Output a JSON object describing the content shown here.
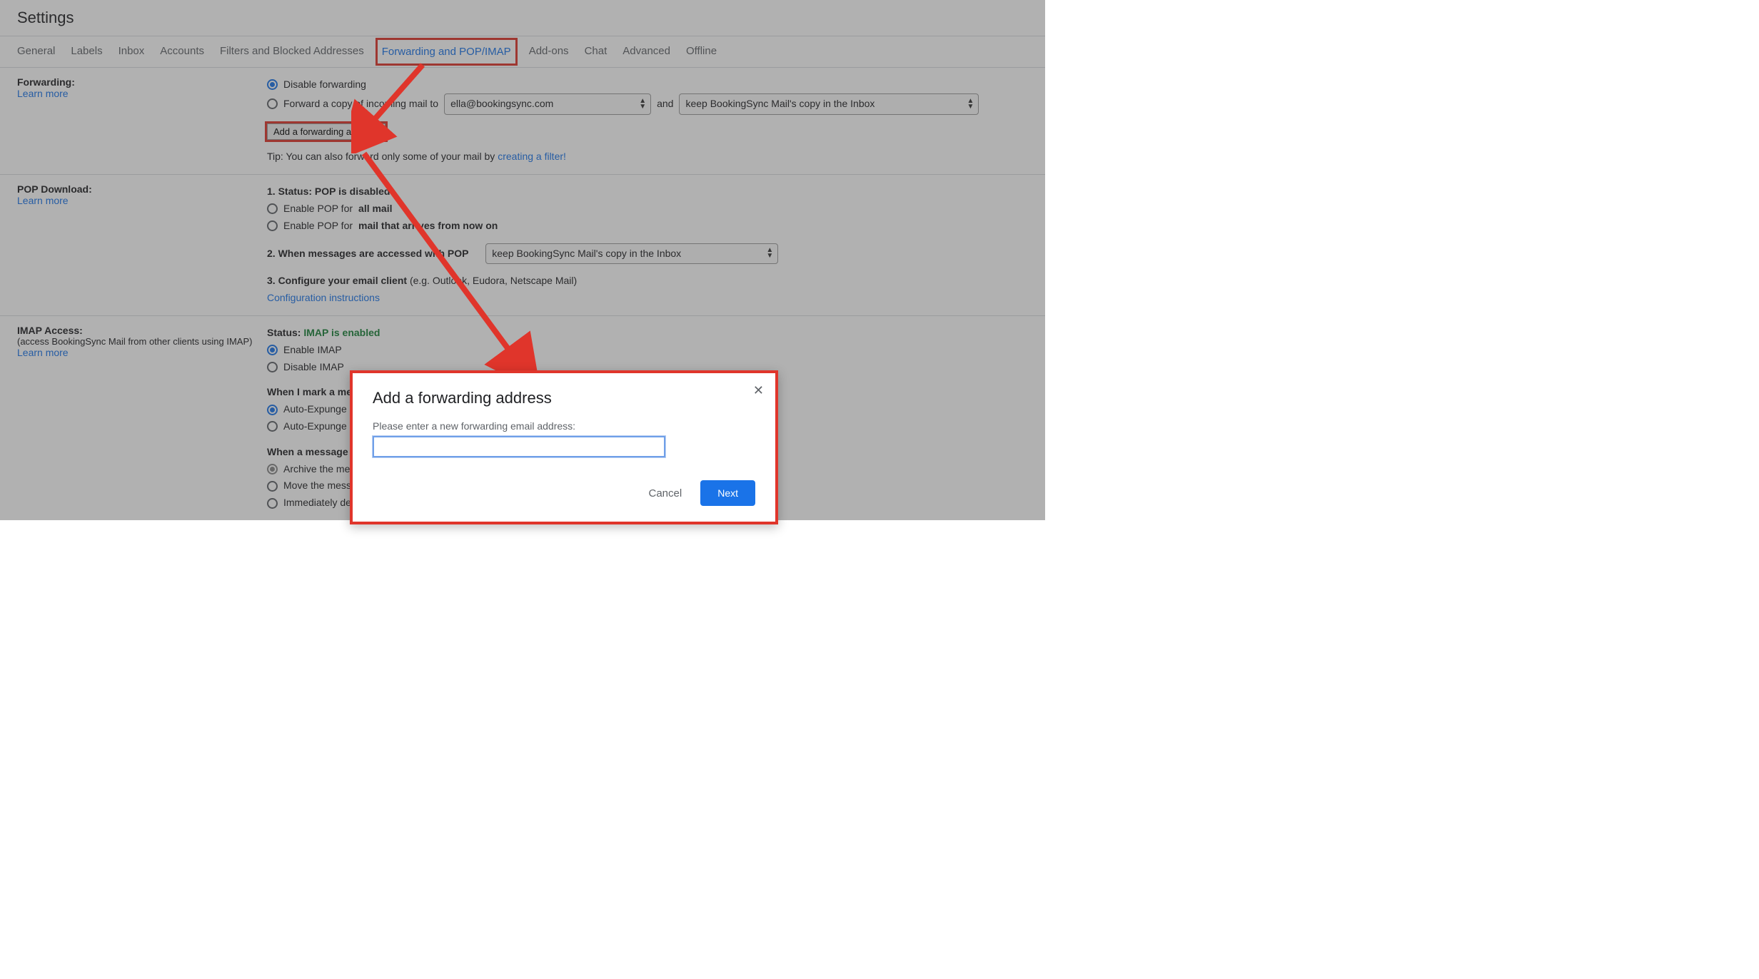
{
  "header": {
    "title": "Settings"
  },
  "tabs": [
    "General",
    "Labels",
    "Inbox",
    "Accounts",
    "Filters and Blocked Addresses",
    "Forwarding and POP/IMAP",
    "Add-ons",
    "Chat",
    "Advanced",
    "Offline"
  ],
  "forwarding": {
    "label": "Forwarding:",
    "learn_more": "Learn more",
    "disable": "Disable forwarding",
    "forward_prefix": "Forward a copy of incoming mail to",
    "forward_email": "ella@bookingsync.com",
    "and": "and",
    "keep_action": "keep BookingSync Mail's copy in the Inbox",
    "add_btn": "Add a forwarding address",
    "tip_prefix": "Tip: You can also forward only some of your mail by ",
    "tip_link": "creating a filter!"
  },
  "pop": {
    "label": "POP Download:",
    "learn_more": "Learn more",
    "status_label": "1. Status: ",
    "status_value": "POP is disabled",
    "enable_all_prefix": "Enable POP for ",
    "enable_all_bold": "all mail",
    "enable_now_prefix": "Enable POP for ",
    "enable_now_bold": "mail that arrives from now on",
    "when_accessed": "2. When messages are accessed with POP",
    "keep_action": "keep BookingSync Mail's copy in the Inbox",
    "configure_label": "3. Configure your email client ",
    "configure_example": "(e.g. Outlook, Eudora, Netscape Mail)",
    "config_link": "Configuration instructions"
  },
  "imap": {
    "label": "IMAP Access:",
    "sub": "(access BookingSync Mail from other clients using IMAP)",
    "learn_more": "Learn more",
    "status_label": "Status: ",
    "status_value": "IMAP is enabled",
    "enable": "Enable IMAP",
    "disable": "Disable IMAP",
    "expunge_label": "When I mark a message in IMAP as deleted:",
    "expunge_on": "Auto-Expunge on",
    "expunge_off": "Auto-Expunge off",
    "removed_label": "When a message is marked as deleted and expunged from the last visible IMAP folder:",
    "archive": "Archive the message",
    "move_trash": "Move the message to the Trash",
    "delete_forever": "Immediately delete the message forever"
  },
  "modal": {
    "title": "Add a forwarding address",
    "label": "Please enter a new forwarding email address:",
    "cancel": "Cancel",
    "next": "Next"
  }
}
